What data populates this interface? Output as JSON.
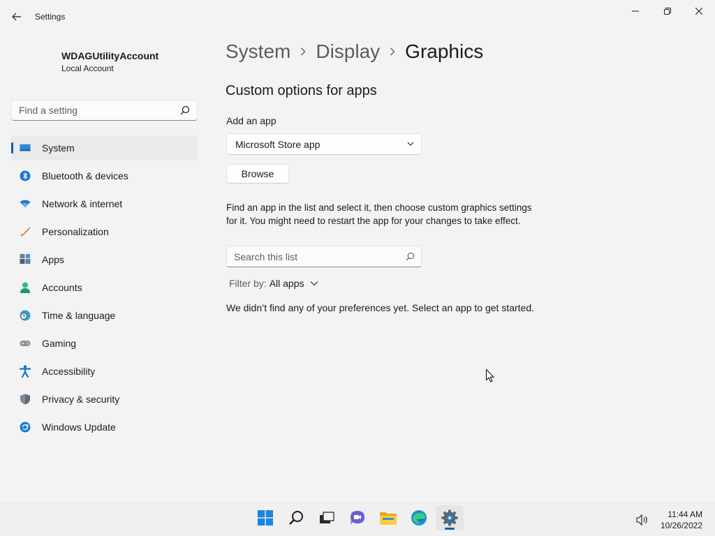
{
  "window": {
    "title": "Settings",
    "back_icon": "back-arrow-icon",
    "minimize_icon": "minimize-icon",
    "maximize_icon": "restore-icon",
    "close_icon": "close-icon"
  },
  "profile": {
    "name": "WDAGUtilityAccount",
    "account_type": "Local Account"
  },
  "sidebar": {
    "search_placeholder": "Find a setting",
    "items": [
      {
        "label": "System",
        "icon": "system-icon",
        "active": true
      },
      {
        "label": "Bluetooth & devices",
        "icon": "bluetooth-icon"
      },
      {
        "label": "Network & internet",
        "icon": "wifi-icon"
      },
      {
        "label": "Personalization",
        "icon": "brush-icon"
      },
      {
        "label": "Apps",
        "icon": "apps-icon"
      },
      {
        "label": "Accounts",
        "icon": "accounts-icon"
      },
      {
        "label": "Time & language",
        "icon": "clock-globe-icon"
      },
      {
        "label": "Gaming",
        "icon": "gamepad-icon"
      },
      {
        "label": "Accessibility",
        "icon": "accessibility-icon"
      },
      {
        "label": "Privacy & security",
        "icon": "shield-icon"
      },
      {
        "label": "Windows Update",
        "icon": "update-icon"
      }
    ]
  },
  "breadcrumb": [
    "System",
    "Display",
    "Graphics"
  ],
  "main": {
    "section_title": "Custom options for apps",
    "add_app_label": "Add an app",
    "app_type_selected": "Microsoft Store app",
    "browse_label": "Browse",
    "help_text": "Find an app in the list and select it, then choose custom graphics settings for it. You might need to restart the app for your changes to take effect.",
    "list_search_placeholder": "Search this list",
    "filter_label": "Filter by:",
    "filter_value": "All apps",
    "empty_message": "We didn’t find any of your preferences yet. Select an app to get started."
  },
  "taskbar": {
    "apps": [
      "start-icon",
      "search-icon",
      "task-view-icon",
      "teams-chat-icon",
      "file-explorer-icon",
      "edge-icon",
      "settings-gear-icon"
    ],
    "active_app": "settings-gear-icon",
    "time": "11:44 AM",
    "date": "10/26/2022"
  },
  "colors": {
    "accent": "#005fb8",
    "background": "#f3f3f3"
  }
}
